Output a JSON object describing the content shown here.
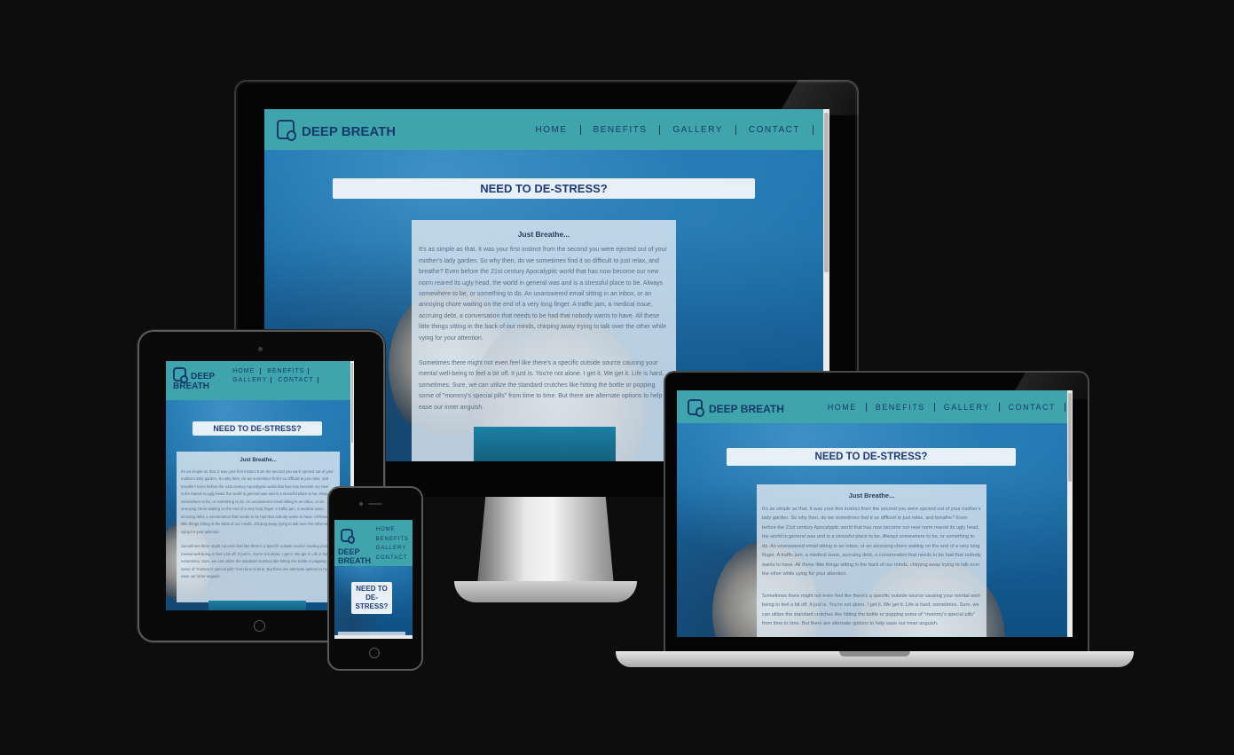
{
  "site": {
    "logo_text": "DEEP BREATH",
    "logo_line1": "DEEP",
    "logo_line2": "BREATH",
    "nav": [
      "HOME",
      "BENEFITS",
      "GALLERY",
      "CONTACT"
    ],
    "hero_title": "NEED TO DE-STRESS?",
    "mobile_hero_lines": [
      "NEED TO",
      "DE-",
      "STRESS?"
    ],
    "card_title": "Just Breathe...",
    "para1": "It's as simple as that. It was your first instinct from the second you were ejected out of your mother's lady garden. So why then, do we sometimes find it so difficult to just relax, and breathe? Even before the 21st century Apocalyptic world that has now become our new norm reared its ugly head, the world in general was and is a stressful place to be. Always somewhere to be, or something to do. An unanswered email sitting in an inbox, or an annoying chore waiting on the end of a very long finger. A traffic jam, a medical issue, accruing debt, a conversation that needs to be had that nobody wants to have. All these little things sitting in the back of our minds, chirping away trying to talk over the other while vying for your attention.",
    "para2": "Sometimes there might not even feel like there's a specific outside source causing your mental well-being to feel a bit off. It just is. You're not alone. I get it. We get it. Life is hard, sometimes. Sure, we can utilize the standard crutches like hitting the bottle or popping some of \"mommy's special pills\" from time to time. But there are alternate options to help ease our inner anguish."
  },
  "colors": {
    "background": "#0d0d0e",
    "navbar": "#3fa4ac",
    "brand_text": "#163a6a",
    "hero_bg": "#e8f0f7"
  },
  "icons": [
    "snorkel-mask-logo-icon",
    "home-button-icon",
    "camera-icon"
  ]
}
